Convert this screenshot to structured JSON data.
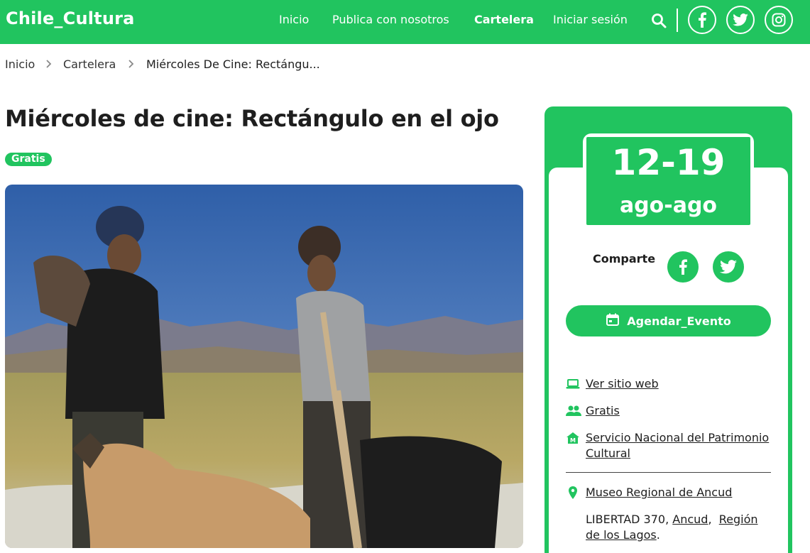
{
  "header": {
    "logo": "Chile_Cultura",
    "nav": [
      {
        "label": "Inicio"
      },
      {
        "label": "Publica con nosotros"
      },
      {
        "label": "Cartelera",
        "active": true
      },
      {
        "label": "Iniciar sesión"
      }
    ],
    "icons": [
      "search-icon",
      "facebook-icon",
      "twitter-icon",
      "instagram-icon"
    ]
  },
  "breadcrumb": [
    "Inicio",
    "Cartelera",
    "Miércoles De Cine: Rectángu..."
  ],
  "event": {
    "title": "Miércoles de cine: Rectángulo en el ojo",
    "tag": "Gratis",
    "date_days": "12-19",
    "date_months": "ago-ago"
  },
  "sidebar": {
    "share_label": "Comparte",
    "agendar_label": "Agendar_Evento",
    "links": {
      "web": "Ver sitio web",
      "price": "Gratis",
      "organizer": "Servicio Nacional del Patrimonio Cultural",
      "venue": "Museo Regional de Ancud"
    },
    "address": {
      "street": "LIBERTAD 370,",
      "city": "Ancud",
      "region": "Región de los Lagos"
    }
  },
  "colors": {
    "brand_green": "#21c45f",
    "text": "#1e1e1e"
  }
}
